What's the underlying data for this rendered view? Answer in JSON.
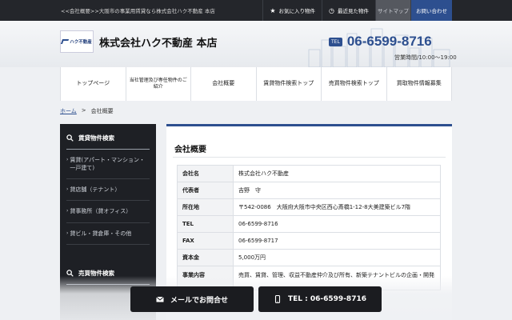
{
  "topbar": {
    "description": "<<会社概要>>大阪市の事業用賃貸なら株式会社ハク不動産 本店",
    "links": [
      {
        "icon": "star-icon",
        "label": "お気に入り物件"
      },
      {
        "icon": "clock-icon",
        "label": "最近見た物件"
      },
      {
        "icon": "",
        "label": "サイトマップ"
      },
      {
        "icon": "",
        "label": "お問い合わせ"
      }
    ]
  },
  "header": {
    "logo_text": "ハク不動産",
    "company_name": "株式会社ハク不動産 本店",
    "tel_badge": "TEL",
    "tel": "06-6599-8716",
    "hours": "営業時間/10:00～19:00"
  },
  "global_nav": [
    "トップページ",
    "当社管理及び専任物件のご紹介",
    "会社概要",
    "賃貸物件検索トップ",
    "売買物件検索トップ",
    "買取物件情報募集"
  ],
  "breadcrumb": {
    "home": "ホーム",
    "separator": ">",
    "current": "会社概要"
  },
  "sidebar": {
    "rent_title": "賃貸物件検索",
    "rent_items": [
      "賃貸(アパート・マンション・一戸建て)",
      "貸店舗（テナント）",
      "貸事務所（貸オフィス）",
      "貸ビル・貸倉庫・その他"
    ],
    "sale_title": "売買物件検索"
  },
  "main": {
    "title": "会社概要",
    "rows": [
      {
        "key": "会社名",
        "value": "株式会社ハク不動産"
      },
      {
        "key": "代表者",
        "value": "吉野　守"
      },
      {
        "key": "所在地",
        "value": "〒542-0086　大阪府大阪市中央区西心斎橋1-12-8大美建築ビル7階"
      },
      {
        "key": "TEL",
        "value": "06-6599-8716"
      },
      {
        "key": "FAX",
        "value": "06-6599-8717"
      },
      {
        "key": "資本金",
        "value": "5,000万円"
      },
      {
        "key": "事業内容",
        "value": "売買、賃貸、管理、収益不動産仲介及び所有、新築テナントビルの企画・開発"
      }
    ]
  },
  "cta": {
    "mail_label": "メールでお問合せ",
    "tel_label": "TEL : 06-6599-8716"
  },
  "colors": {
    "accent": "#2d4f8f",
    "dark": "#1e2025",
    "topbar": "#24262b"
  }
}
